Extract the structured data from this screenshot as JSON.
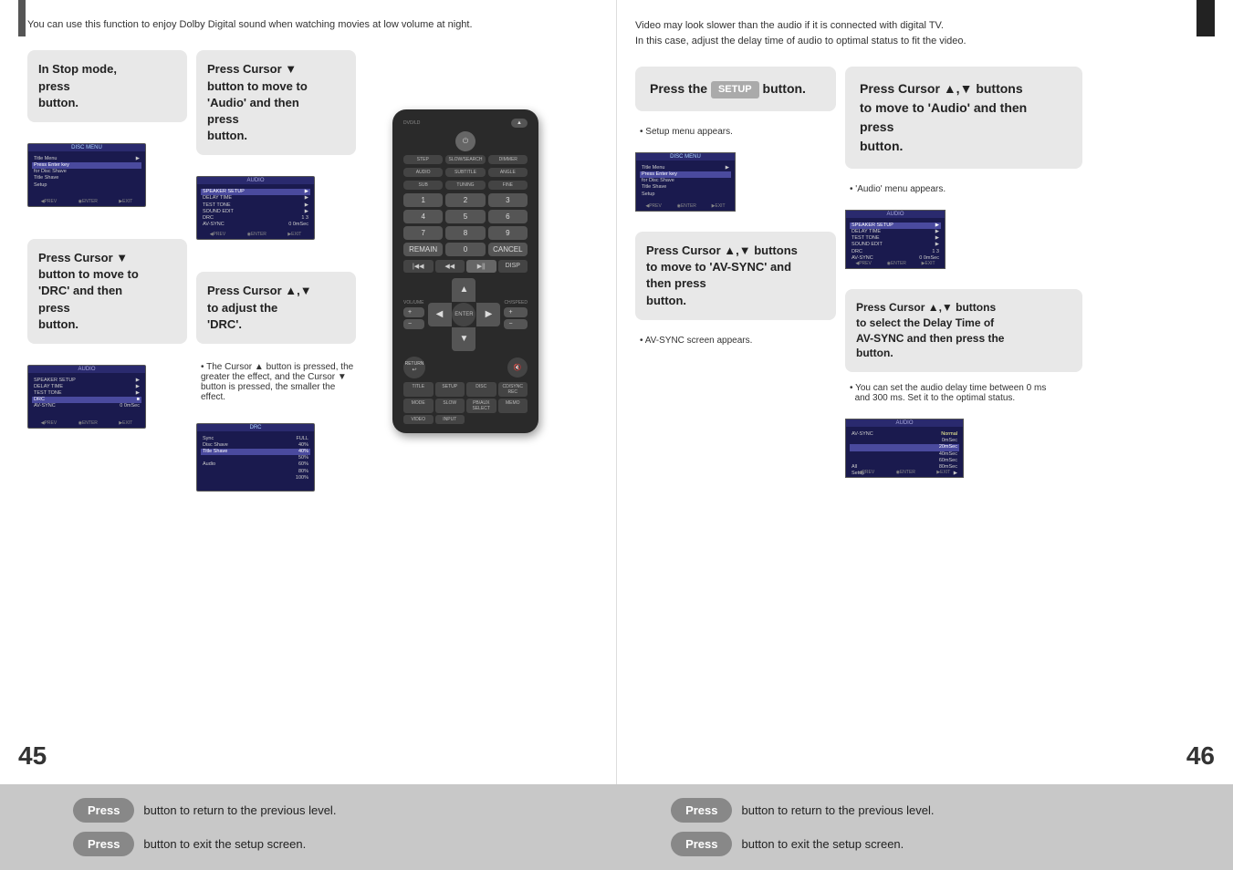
{
  "leftPage": {
    "headerText": "You can use this function to enjoy Dolby Digital sound when watching movies at low volume at night.",
    "box1": {
      "line1": "In Stop mode,",
      "line2": "press",
      "line3": "button."
    },
    "box2": {
      "line1": "Press Cursor ▼",
      "line2": "button to move to",
      "line3": "'Audio' and then",
      "line4": "press",
      "line5": "button."
    },
    "box3": {
      "line1": "Press Cursor ▼",
      "line2": "button to move to",
      "line3": "'DRC' and then",
      "line4": "press",
      "line5": "button."
    },
    "box4": {
      "line1": "Press Cursor ▲,▼",
      "line2": "to adjust the",
      "line3": "'DRC'."
    },
    "bulletText3": "The Cursor ▲ button is pressed, the greater the effect, and the Cursor ▼ button is pressed, the smaller the effect.",
    "pageNumber": "45"
  },
  "rightPage": {
    "headerText1": "Video may look slower than the audio if it is connected with digital TV.",
    "headerText2": "In this case, adjust the delay time of audio to optimal status to fit the video.",
    "box1": {
      "line1": "Press the",
      "line2": "button."
    },
    "bullet1": "Setup menu appears.",
    "box2": {
      "line1": "Press Cursor ▲,▼ buttons",
      "line2": "to move to 'AV-SYNC' and",
      "line3": "then press",
      "line4": "button."
    },
    "bullet2": "AV-SYNC screen appears.",
    "box3": {
      "line1": "Press Cursor ▲,▼ buttons",
      "line2": "to move to 'Audio' and then",
      "line3": "press",
      "line4": "button."
    },
    "bullet3": "'Audio' menu appears.",
    "box4": {
      "line1": "Press Cursor  ▲,▼ buttons",
      "line2": "to select the Delay Time of",
      "line3": "AV-SYNC and then press the",
      "line4": "button."
    },
    "bullet4a": "You can set the audio delay time between 0 ms",
    "bullet4b": "and 300 ms. Set it to the optimal status.",
    "pageNumber": "46"
  },
  "footer": {
    "leftPress1Label": "Press",
    "leftPress1Text": "button to return to the previous level.",
    "leftPress2Label": "Press",
    "leftPress2Text": "button to exit the setup screen.",
    "rightPress1Label": "Press",
    "rightPress1Text": "button to return to the previous level.",
    "rightPress2Label": "Press",
    "rightPress2Text": "button to exit the setup screen."
  }
}
